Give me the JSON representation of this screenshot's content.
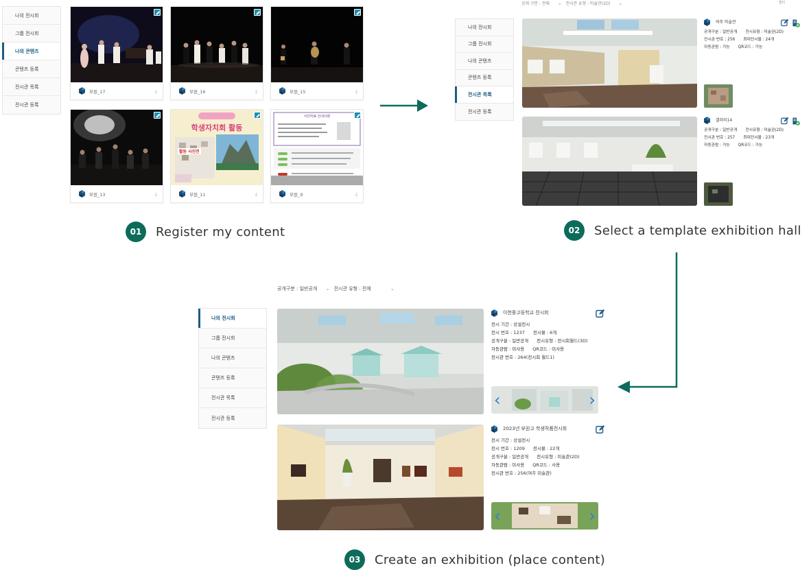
{
  "sidebar_steps": {
    "step1": [
      "나의 전시회",
      "그룹 전시회",
      "나의 콘텐츠",
      "콘텐츠 등록",
      "전시관 목록",
      "전시관 등록"
    ],
    "step2": [
      "나의 전시회",
      "그룹 전시회",
      "나의 콘텐츠",
      "콘텐츠 등록",
      "전시관 목록",
      "전시관 등록"
    ],
    "step3": [
      "나의 전시회",
      "그룹 전시회",
      "나의 콘텐츠",
      "콘텐츠 등록",
      "전시관 목록",
      "전시관 등록"
    ]
  },
  "cards": [
    {
      "name": "부원_17",
      "count": "0"
    },
    {
      "name": "부원_16",
      "count": "0"
    },
    {
      "name": "부원_15",
      "count": "0"
    },
    {
      "name": "부원_13",
      "count": "0"
    },
    {
      "name": "부원_11",
      "count": "0"
    },
    {
      "name": "부원_9",
      "count": "0"
    }
  ],
  "card_texts": {
    "poster_title": "학생자치회 활동",
    "poster_sub": "활동 사진전",
    "doc_header": "사진자료 안내사항"
  },
  "steps": [
    {
      "num": "01",
      "label": "Register my content"
    },
    {
      "num": "02",
      "label": "Select a template exhibition hall"
    },
    {
      "num": "03",
      "label": "Create an exhibition (place content)"
    }
  ],
  "step2_filters": {
    "a": "공개 구분 : 전체",
    "b": "전시관 유형 : 미술관(2D)",
    "right": "필터"
  },
  "halls": [
    {
      "title": "여주 미술관",
      "line1a": "공개구분 : 일반공개",
      "line1b": "전시유형 : 미술관(2D)",
      "line2a": "전시관 번호 : 256",
      "line2b": "최대전시물 : 24개",
      "line3a": "자동관람 : 가능",
      "line3b": "QR코드 : 가능"
    },
    {
      "title": "갤러리14",
      "line1a": "공개구분 : 일반공개",
      "line1b": "전시유형 : 미술관(2D)",
      "line2a": "전시관 번호 : 257",
      "line2b": "최대전시물 : 23개",
      "line3a": "자동관람 : 가능",
      "line3b": "QR코드 : 가능"
    }
  ],
  "step3_filters": {
    "a": "공개구분 : 일반공개",
    "b": "전시관 유형 : 전체"
  },
  "exhibitions": [
    {
      "title": "이천중고등학교 전시회",
      "l1": "전시 기간 : 상설전시",
      "l2a": "전시 번호 : 1237",
      "l2b": "전시물 : 6개",
      "l3a": "공개구분 : 일반공개",
      "l3b": "전시유형 : 전시회월드(3D)",
      "l4a": "자동관람 : 미사용",
      "l4b": "QR코드 : 미사용",
      "l5": "전시관 번호 : 264(전시회 월드1)"
    },
    {
      "title": "2023년 부원고 학생작품전시회",
      "l1": "전시 기간 : 상설전시",
      "l2a": "전시 번호 : 1209",
      "l2b": "전시물 : 22개",
      "l3a": "공개구분 : 일반공개",
      "l3b": "전시유형 : 미술관(2D)",
      "l4a": "자동관람 : 미사용",
      "l4b": "QR코드 : 사용",
      "l5": "전시관 번호 : 256(여주 미술관)"
    }
  ],
  "icons": {
    "edit": "edit-icon",
    "add": "add-gallery-icon",
    "download": "download-icon",
    "logo": "org-logo-icon",
    "arrow": "arrow-icon",
    "prev": "chevron-left-icon",
    "next": "chevron-right-icon"
  },
  "colors": {
    "accent": "#0d6b5a",
    "nav_active": "#1d5b84",
    "chevron": "#2d7fd6",
    "edit": "#1d8fb3"
  }
}
